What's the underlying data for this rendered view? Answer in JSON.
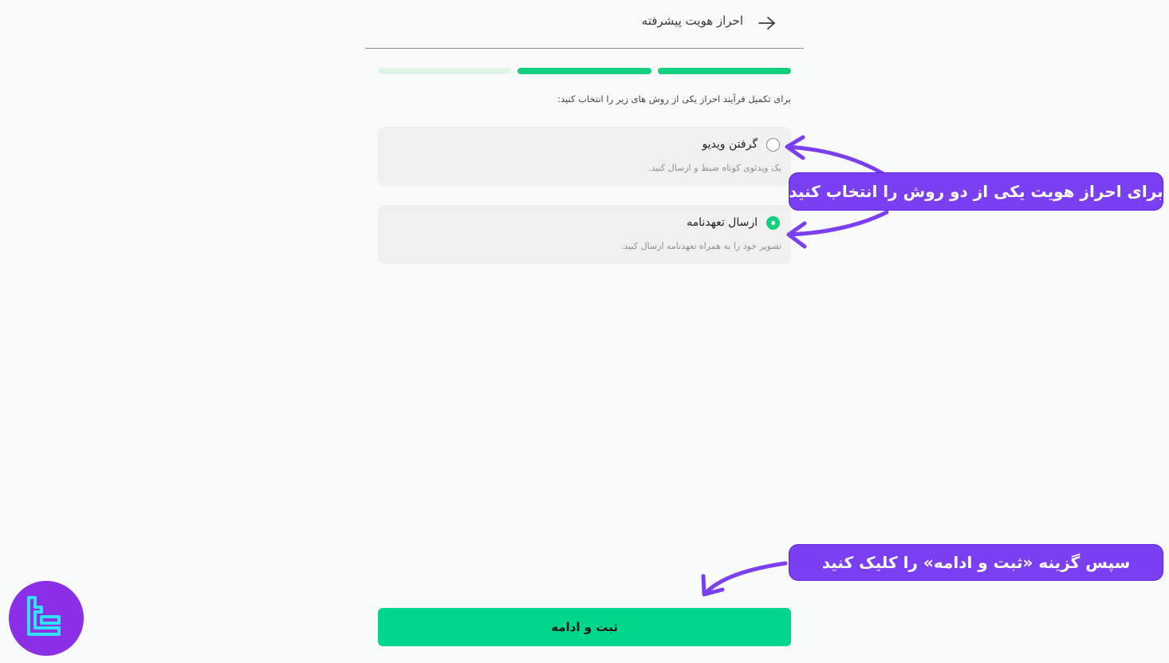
{
  "header": {
    "title": "احراز هویت پیشرفته",
    "back_icon": "arrow-right-icon"
  },
  "progress": {
    "total_steps": 3,
    "completed_steps": 2,
    "active_color": "#14d07e",
    "inactive_color": "#dff3e6"
  },
  "instruction": "برای تکمیل فرآیند احراز یکی از روش های زیر را انتخاب کنید:",
  "options": [
    {
      "title": "گرفتن ویدیو",
      "description": "یک ویدئوی کوتاه ضبط و ارسال کنید.",
      "selected": false
    },
    {
      "title": "ارسال تعهدنامه",
      "description": "تصویر خود را به همراه تعهدنامه ارسال کنید.",
      "selected": true
    }
  ],
  "annotations": {
    "choose_method": "برای احراز هویت یکی از دو روش را انتخاب کنید",
    "click_submit": "سپس گزینه «ثبت و ادامه» را کلیک کنید"
  },
  "submit": {
    "label": "ثبت و ادامه",
    "color": "#00d78c"
  },
  "colors": {
    "accent": "#14d07e",
    "annotation": "#7b3ff2",
    "logo_bg": "#8a2fe6",
    "logo_mark": "#2fe0ff"
  },
  "logo": {
    "icon": "brand-logo-icon"
  }
}
